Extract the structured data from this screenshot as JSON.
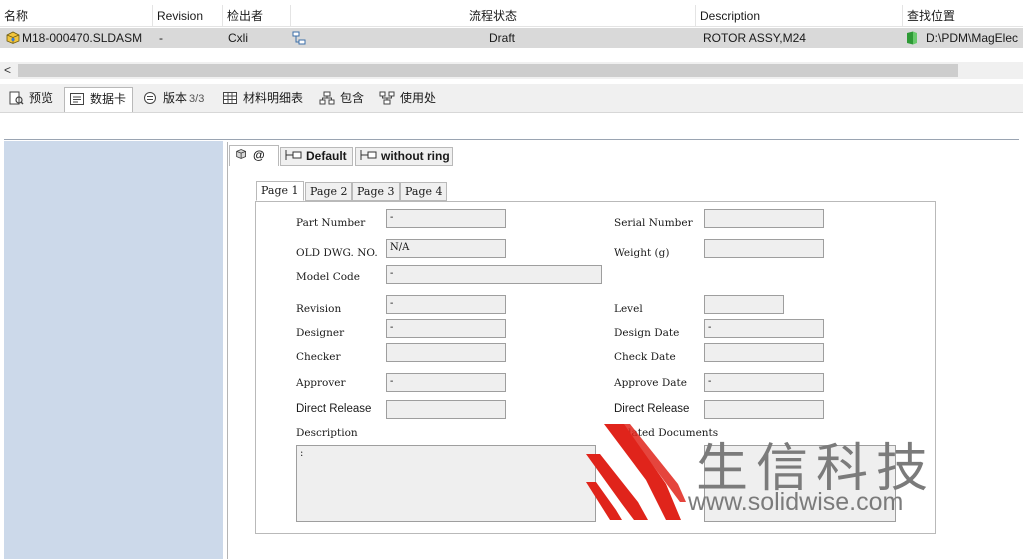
{
  "list": {
    "columns": [
      "名称",
      "Revision",
      "检出者",
      "流程状态",
      "Description",
      "查找位置"
    ],
    "row": {
      "name": "M18-000470.SLDASM",
      "revision": "-",
      "checked_out_by": "Cxli",
      "workflow_state": "Draft",
      "description": "ROTOR ASSY,M24",
      "found_in": "D:\\PDM\\MagElec"
    },
    "scroll_arrow": "<"
  },
  "tabs": [
    {
      "label": "预览",
      "sub": "",
      "icon": "preview-icon"
    },
    {
      "label": "数据卡",
      "sub": "",
      "icon": "datacard-icon"
    },
    {
      "label": "版本",
      "sub": "3/3",
      "icon": "version-icon"
    },
    {
      "label": "材料明细表",
      "sub": "",
      "icon": "bom-icon"
    },
    {
      "label": "包含",
      "sub": "",
      "icon": "contains-icon"
    },
    {
      "label": "使用处",
      "sub": "",
      "icon": "where-used-icon"
    }
  ],
  "config_tabs": [
    {
      "label": "@",
      "icon": "part-icon"
    },
    {
      "label": "Default",
      "icon": "config-icon"
    },
    {
      "label": "without ring",
      "icon": "config-icon"
    }
  ],
  "page_tabs": [
    "Page 1",
    "Page 2",
    "Page 3",
    "Page 4"
  ],
  "form": {
    "part_number": {
      "label": "Part Number",
      "value": "-"
    },
    "serial_number": {
      "label": "Serial Number",
      "value": ""
    },
    "old_dwg_no": {
      "label": "OLD DWG. NO.",
      "value": "N/A"
    },
    "weight": {
      "label": "Weight (g)",
      "value": ""
    },
    "model_code": {
      "label": "Model Code",
      "value": "-"
    },
    "revision": {
      "label": "Revision",
      "value": "-"
    },
    "level": {
      "label": "Level",
      "value": ""
    },
    "designer": {
      "label": "Designer",
      "value": "-"
    },
    "design_date": {
      "label": "Design Date",
      "value": "-"
    },
    "checker": {
      "label": "Checker",
      "value": ""
    },
    "check_date": {
      "label": "Check Date",
      "value": ""
    },
    "approver": {
      "label": "Approver",
      "value": "-"
    },
    "approve_date": {
      "label": "Approve Date",
      "value": "-"
    },
    "direct_release_left": {
      "label": "Direct Release",
      "value": ""
    },
    "direct_release_right": {
      "label": "Direct Release",
      "value": ""
    },
    "description": {
      "label": "Description",
      "value": ":"
    },
    "related_documents": {
      "label": "Related Documents",
      "value": ""
    }
  },
  "watermark": {
    "cn": "生信科技",
    "url": "www.solidwise.com"
  },
  "colors": {
    "selected_row": "#d9d9d9",
    "left_pane": "#ccd9ea",
    "watermark_red": "#e0241b",
    "watermark_gray": "#7b7b7b"
  }
}
